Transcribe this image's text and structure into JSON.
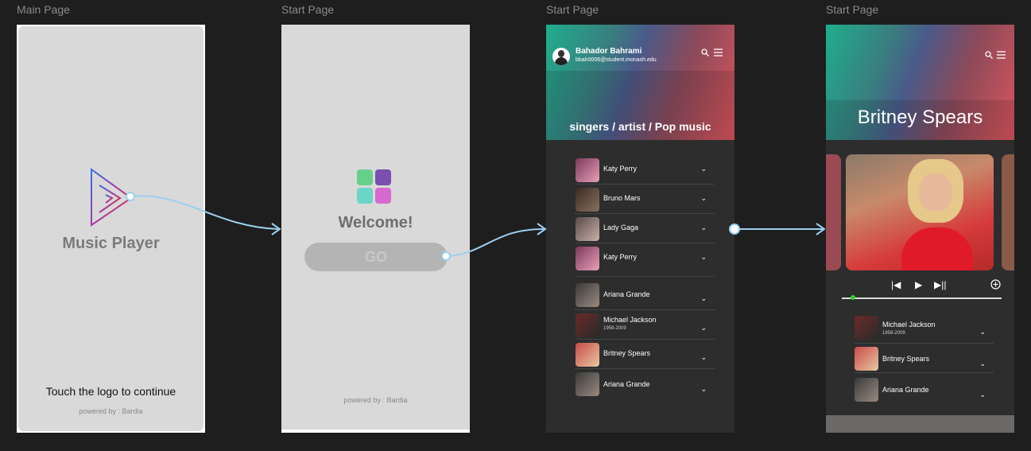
{
  "frames": [
    {
      "label": "Main Page"
    },
    {
      "label": "Start Page"
    },
    {
      "label": "Start Page"
    },
    {
      "label": "Start Page"
    }
  ],
  "main_page": {
    "app_name": "Music Player",
    "hint": "Touch the logo to continue",
    "powered_by": "powered by : Bardia"
  },
  "start_page": {
    "welcome": "Welcome!",
    "go_label": "GO",
    "powered_by": "powered by : Bardia",
    "tile_colors": [
      "#66d08a",
      "#7a4fb0",
      "#6ad6c6",
      "#d66ad0"
    ]
  },
  "artists_page": {
    "user_name": "Bahador Bahrami",
    "user_email": "bbah0006@student.monash.edu",
    "section_title": "singers / artist / Pop music",
    "artists": [
      {
        "name": "Katy Perry",
        "sub": ""
      },
      {
        "name": "Bruno Mars",
        "sub": ""
      },
      {
        "name": "Lady Gaga",
        "sub": ""
      },
      {
        "name": "Katy Perry",
        "sub": ""
      },
      {
        "name": "Ariana Grande",
        "sub": ""
      },
      {
        "name": "Michael Jackson",
        "sub": "1958-2009"
      },
      {
        "name": "Britney Spears",
        "sub": ""
      },
      {
        "name": "Ariana Grande",
        "sub": ""
      }
    ]
  },
  "player_page": {
    "artist_name": "Britney Spears",
    "progress": 0.07,
    "queue": [
      {
        "name": "Michael Jackson",
        "sub": "1958-2009"
      },
      {
        "name": "Britney Spears",
        "sub": ""
      },
      {
        "name": "Ariana Grande",
        "sub": ""
      }
    ]
  },
  "icons": {
    "search": "search-icon",
    "menu": "menu-icon",
    "chevron": "chevron-down-icon",
    "prev": "previous-icon",
    "play": "play-icon",
    "next": "next-icon",
    "add": "add-circle-icon"
  },
  "colors": {
    "canvas": "#1e1e1e",
    "card_grey": "#d9d9d9",
    "dark_panel": "#2d2d2d",
    "arrow": "#9ccfee",
    "progress_dot": "#2ed52e"
  }
}
